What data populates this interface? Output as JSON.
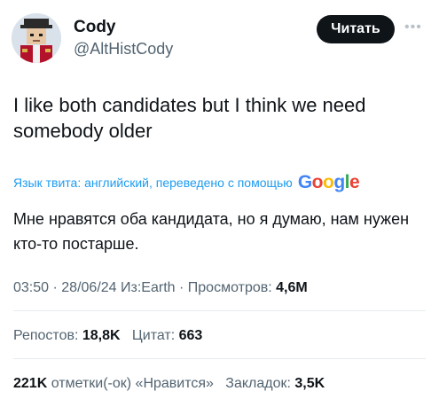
{
  "author": {
    "name": "Cody",
    "handle": "@AltHistCody"
  },
  "follow_label": "Читать",
  "more_icon": "more-icon",
  "tweet_text": "I like both candidates but I think we need somebody older",
  "translation": {
    "label": "Язык твита: английский, переведено с помощью",
    "google": "Google",
    "text": "Мне нравятся оба кандидата, но я думаю, нам нужен кто-то постарше."
  },
  "meta": {
    "time": "03:50",
    "date": "28/06/24",
    "source": "Из:Earth",
    "views_label": "Просмотров:",
    "views": "4,6M"
  },
  "stats": {
    "reposts_label": "Репостов:",
    "reposts": "18,8K",
    "quotes_label": "Цитат:",
    "quotes": "663",
    "likes": "221K",
    "likes_label": "отметки(-ок) «Нравится»",
    "bookmarks_label": "Закладок:",
    "bookmarks": "3,5K"
  },
  "colors": {
    "link": "#1d9bf0",
    "secondary": "#536471",
    "text": "#0f1419",
    "google_blue": "#4285F4",
    "google_red": "#EA4335",
    "google_yellow": "#FBBC05",
    "google_green": "#34A853"
  }
}
